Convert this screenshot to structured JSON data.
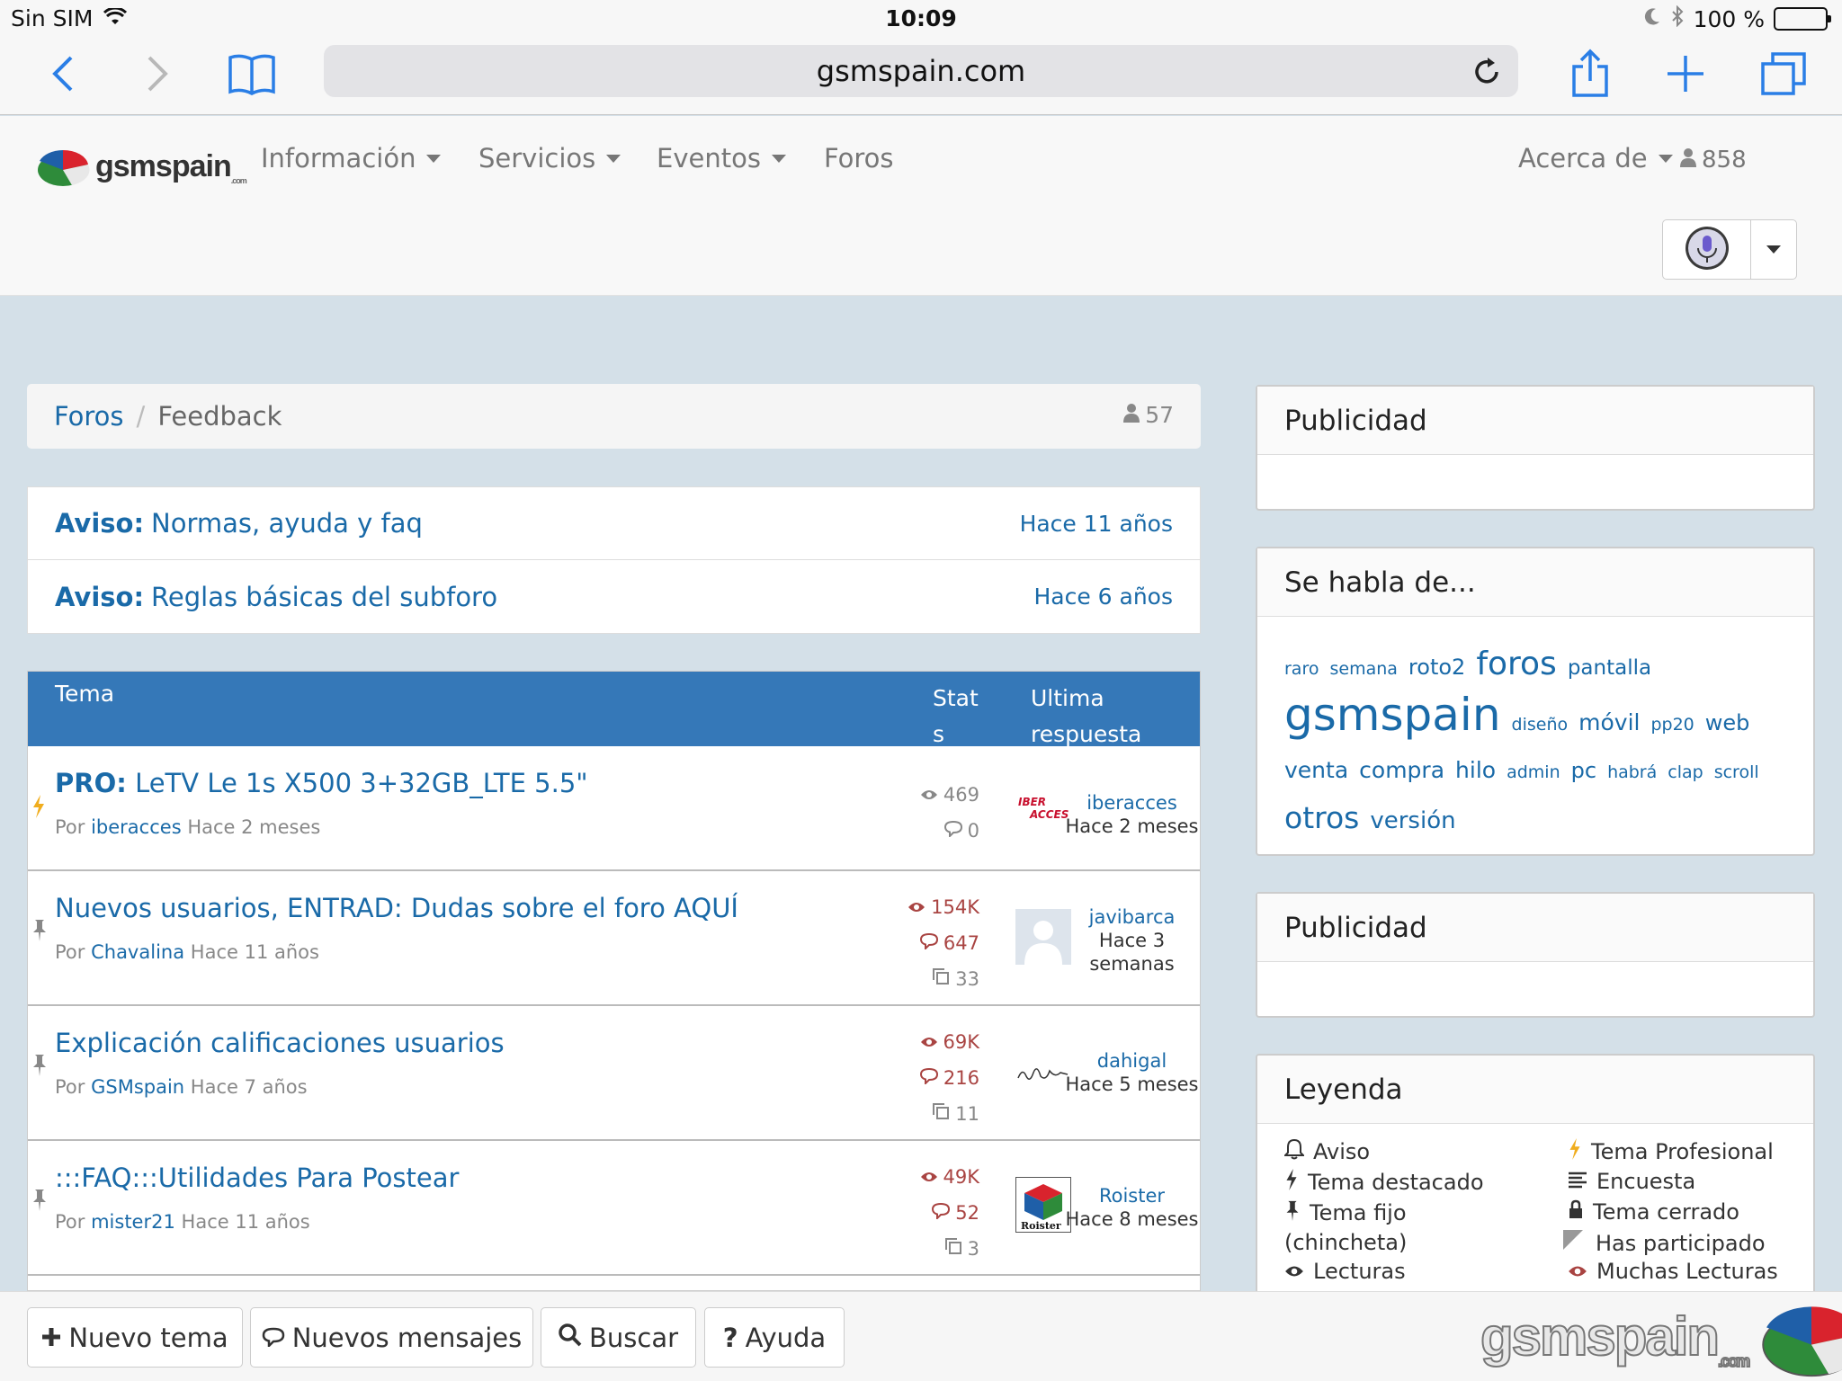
{
  "status_bar": {
    "carrier": "Sin SIM",
    "time": "10:09",
    "battery": "100 %"
  },
  "browser": {
    "url": "gsmspain.com"
  },
  "header": {
    "logo_text": "gsmspain",
    "logo_sub": ".com",
    "nav": [
      {
        "label": "Información",
        "dropdown": true
      },
      {
        "label": "Servicios",
        "dropdown": true
      },
      {
        "label": "Eventos",
        "dropdown": true
      },
      {
        "label": "Foros",
        "dropdown": false
      }
    ],
    "about": "Acerca de",
    "online_count": "858"
  },
  "breadcrumb": {
    "root": "Foros",
    "current": "Feedback",
    "viewers": "57"
  },
  "notices": [
    {
      "prefix": "Aviso:",
      "title": "Normas, ayuda y faq",
      "time": "Hace 11 años"
    },
    {
      "prefix": "Aviso:",
      "title": "Reglas básicas del subforo",
      "time": "Hace 6 años"
    }
  ],
  "topics_table": {
    "headers": {
      "topic": "Tema",
      "stats": "Stats",
      "last": "Ultima respuesta"
    },
    "rows": [
      {
        "prefix": "PRO:",
        "title": "LeTV Le 1s X500 3+32GB_LTE 5.5\"",
        "by_label": "Por",
        "author": "iberacces",
        "age": "Hace 2 meses",
        "views": "469",
        "replies": "0",
        "pages": "",
        "hot": false,
        "last_user": "iberacces",
        "last_time": "Hace 2 meses",
        "marker": "bolt"
      },
      {
        "prefix": "",
        "title": "Nuevos usuarios, ENTRAD: Dudas sobre el foro AQUÍ",
        "by_label": "Por",
        "author": "Chavalina",
        "age": "Hace 11 años",
        "views": "154K",
        "replies": "647",
        "pages": "33",
        "hot": true,
        "last_user": "javibarca",
        "last_time": "Hace 3 semanas",
        "marker": "pin"
      },
      {
        "prefix": "",
        "title": "Explicación calificaciones usuarios",
        "by_label": "Por",
        "author": "GSMspain",
        "age": "Hace 7 años",
        "views": "69K",
        "replies": "216",
        "pages": "11",
        "hot": true,
        "last_user": "dahigal",
        "last_time": "Hace 5 meses",
        "marker": "pin"
      },
      {
        "prefix": "",
        "title": ":::FAQ:::Utilidades Para Postear",
        "by_label": "Por",
        "author": "mister21",
        "age": "Hace 11 años",
        "views": "49K",
        "replies": "52",
        "pages": "3",
        "hot": true,
        "last_user": "Roister",
        "last_time": "Hace 8 meses",
        "marker": "pin"
      }
    ],
    "avatar_labels": {
      "iberacces": "IBER ACCES",
      "dahigal": "dahigal",
      "roister": "Roister"
    }
  },
  "sidebar": {
    "ad1_title": "Publicidad",
    "tags_title": "Se habla de...",
    "tags": [
      {
        "text": "raro",
        "size": 19
      },
      {
        "text": "semana",
        "size": 19
      },
      {
        "text": "roto2",
        "size": 24
      },
      {
        "text": "foros",
        "size": 36
      },
      {
        "text": "pantalla",
        "size": 23
      },
      {
        "text": "gsmspain",
        "size": 50
      },
      {
        "text": "diseño",
        "size": 19
      },
      {
        "text": "móvil",
        "size": 25
      },
      {
        "text": "pp20",
        "size": 19
      },
      {
        "text": "web",
        "size": 24
      },
      {
        "text": "venta",
        "size": 25
      },
      {
        "text": "compra",
        "size": 25
      },
      {
        "text": "hilo",
        "size": 25
      },
      {
        "text": "admin",
        "size": 19
      },
      {
        "text": "pc",
        "size": 24
      },
      {
        "text": "habrá",
        "size": 19
      },
      {
        "text": "clap",
        "size": 19
      },
      {
        "text": "scroll",
        "size": 19
      },
      {
        "text": "otros",
        "size": 33
      },
      {
        "text": "versión",
        "size": 26
      }
    ],
    "ad2_title": "Publicidad",
    "legend_title": "Leyenda",
    "legend": {
      "aviso": "Aviso",
      "destacado": "Tema destacado",
      "fijo": "Tema fijo",
      "fijo2": "(chincheta)",
      "lecturas": "Lecturas",
      "profesional": "Tema Profesional",
      "encuesta": "Encuesta",
      "cerrado": "Tema cerrado",
      "participado": "Has participado",
      "muchas": "Muchas Lecturas"
    }
  },
  "bottom_bar": {
    "new_topic": "Nuevo tema",
    "new_messages": "Nuevos mensajes",
    "search": "Buscar",
    "help": "Ayuda",
    "watermark": "gsmspain",
    "watermark_sub": ".com"
  },
  "colors": {
    "link": "#1a6aa8",
    "table_header": "#3578b8",
    "hot": "#a94442",
    "page_bg": "#d4e0e8"
  }
}
